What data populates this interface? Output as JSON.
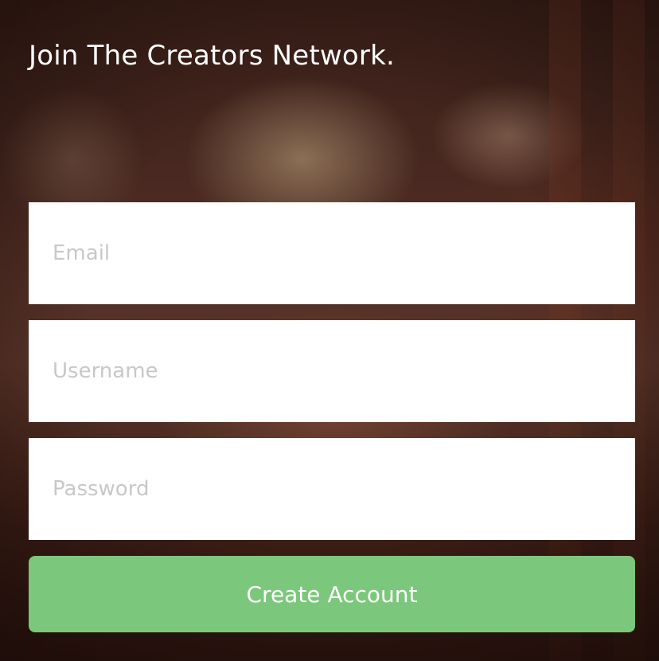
{
  "signup": {
    "title": "Join The Creators Network.",
    "email_placeholder": "Email",
    "username_placeholder": "Username",
    "password_placeholder": "Password",
    "submit_label": "Create Account",
    "accent_color": "#7BC77B"
  }
}
